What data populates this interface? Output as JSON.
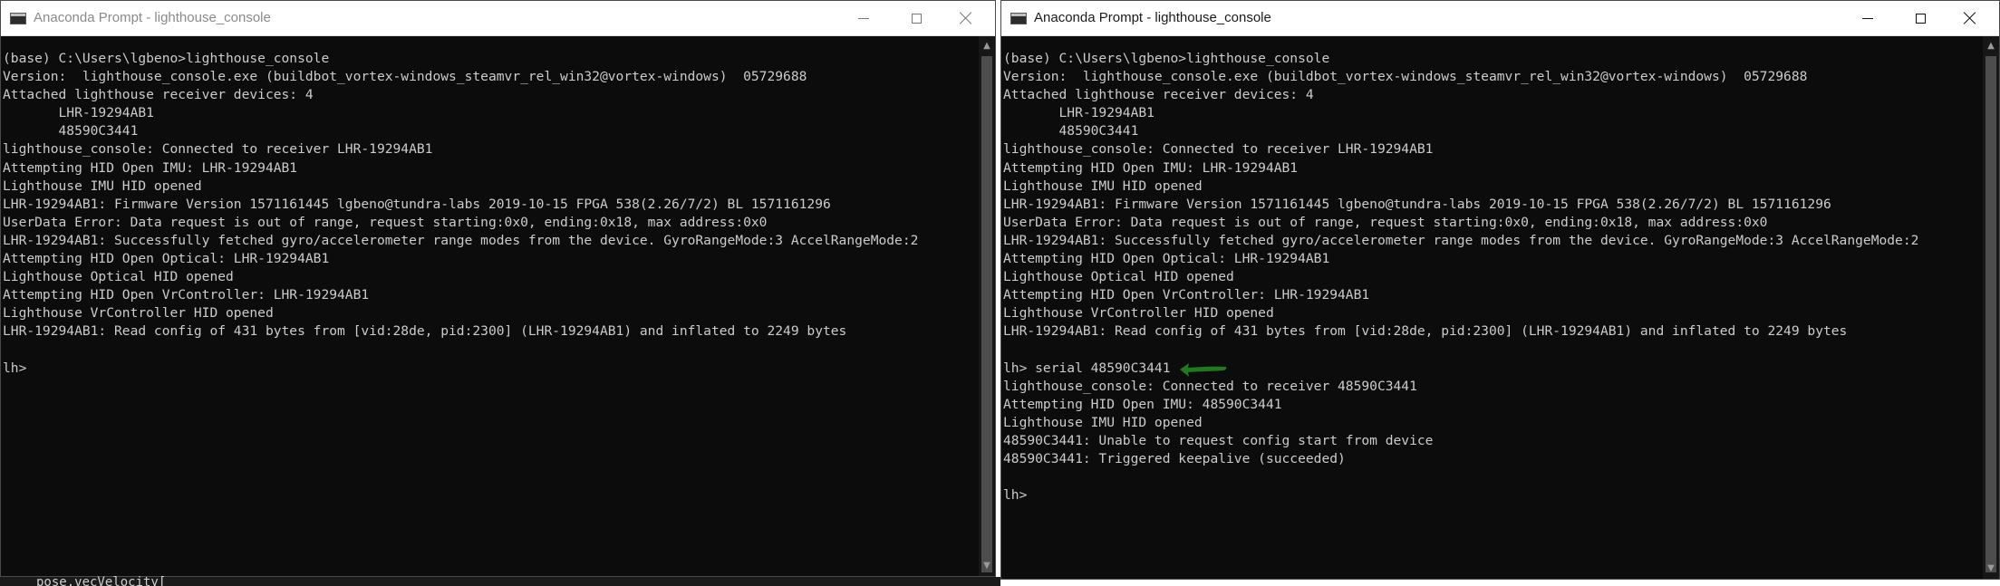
{
  "left_window": {
    "title": "Anaconda Prompt - lighthouse_console",
    "lines": [
      "(base) C:\\Users\\lgbeno>lighthouse_console",
      "Version:  lighthouse_console.exe (buildbot_vortex-windows_steamvr_rel_win32@vortex-windows)  05729688",
      "Attached lighthouse receiver devices: 4",
      "       LHR-19294AB1",
      "       48590C3441",
      "lighthouse_console: Connected to receiver LHR-19294AB1",
      "Attempting HID Open IMU: LHR-19294AB1",
      "Lighthouse IMU HID opened",
      "LHR-19294AB1: Firmware Version 1571161445 lgbeno@tundra-labs 2019-10-15 FPGA 538(2.26/7/2) BL 1571161296",
      "UserData Error: Data request is out of range, request starting:0x0, ending:0x18, max address:0x0",
      "LHR-19294AB1: Successfully fetched gyro/accelerometer range modes from the device. GyroRangeMode:3 AccelRangeMode:2",
      "Attempting HID Open Optical: LHR-19294AB1",
      "Lighthouse Optical HID opened",
      "Attempting HID Open VrController: LHR-19294AB1",
      "Lighthouse VrController HID opened",
      "LHR-19294AB1: Read config of 431 bytes from [vid:28de, pid:2300] (LHR-19294AB1) and inflated to 2249 bytes",
      "",
      "lh>"
    ]
  },
  "right_window": {
    "title": "Anaconda Prompt - lighthouse_console",
    "lines": [
      "(base) C:\\Users\\lgbeno>lighthouse_console",
      "Version:  lighthouse_console.exe (buildbot_vortex-windows_steamvr_rel_win32@vortex-windows)  05729688",
      "Attached lighthouse receiver devices: 4",
      "       LHR-19294AB1",
      "       48590C3441",
      "lighthouse_console: Connected to receiver LHR-19294AB1",
      "Attempting HID Open IMU: LHR-19294AB1",
      "Lighthouse IMU HID opened",
      "LHR-19294AB1: Firmware Version 1571161445 lgbeno@tundra-labs 2019-10-15 FPGA 538(2.26/7/2) BL 1571161296",
      "UserData Error: Data request is out of range, request starting:0x0, ending:0x18, max address:0x0",
      "LHR-19294AB1: Successfully fetched gyro/accelerometer range modes from the device. GyroRangeMode:3 AccelRangeMode:2",
      "Attempting HID Open Optical: LHR-19294AB1",
      "Lighthouse Optical HID opened",
      "Attempting HID Open VrController: LHR-19294AB1",
      "Lighthouse VrController HID opened",
      "LHR-19294AB1: Read config of 431 bytes from [vid:28de, pid:2300] (LHR-19294AB1) and inflated to 2249 bytes",
      "",
      "lh> serial 48590C3441",
      "lighthouse_console: Connected to receiver 48590C3441",
      "Attempting HID Open IMU: 48590C3441",
      "Lighthouse IMU HID opened",
      "48590C3441: Unable to request config start from device",
      "48590C3441: Triggered keepalive (succeeded)",
      "",
      "lh>"
    ]
  },
  "background_peek_text": "pose.vecVelocity[",
  "colors": {
    "console_bg": "#0c0c0c",
    "console_text": "#cccccc",
    "arrow_annotation": "#1f7a1f"
  },
  "icons": {
    "window_icon": "console-window-icon",
    "minimize": "minimize-icon",
    "maximize": "maximize-icon",
    "close": "close-icon"
  }
}
